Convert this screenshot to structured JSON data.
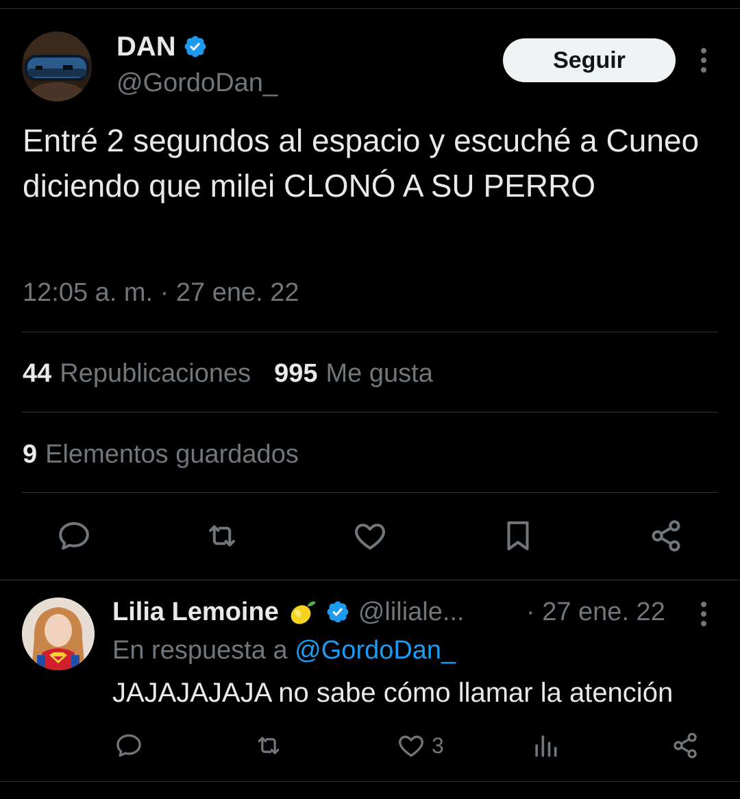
{
  "tweet": {
    "display_name": "DAN",
    "handle": "@GordoDan_",
    "follow_label": "Seguir",
    "text": "Entré 2 segundos al espacio y escuché a Cuneo diciendo que milei CLONÓ A SU PERRO",
    "timestamp": "12:05 a. m. · 27 ene. 22",
    "stats": {
      "reposts_count": "44",
      "reposts_label": "Republicaciones",
      "likes_count": "995",
      "likes_label": "Me gusta",
      "bookmarks_count": "9",
      "bookmarks_label": "Elementos guardados"
    },
    "actions": [
      "comment-icon",
      "repost-icon",
      "like-icon",
      "bookmark-icon",
      "share-icon"
    ]
  },
  "reply": {
    "display_name": "Lilia Lemoine",
    "emoji_icon": "lemon-icon",
    "handle": "@liliale...",
    "date": "· 27 ene. 22",
    "reply_prefix": "En respuesta a",
    "reply_to_handle": "@GordoDan_",
    "text": "JAJAJAJAJA no sabe cómo llamar la atención",
    "likes_count": "3",
    "actions": [
      "comment-icon",
      "repost-icon",
      "like-icon",
      "views-icon",
      "share-icon"
    ]
  },
  "colors": {
    "background": "#000000",
    "text_primary": "#e7e9ea",
    "text_secondary": "#71767b",
    "accent": "#1d9bf0",
    "divider": "#2f3336",
    "button_bg": "#eff3f4"
  }
}
